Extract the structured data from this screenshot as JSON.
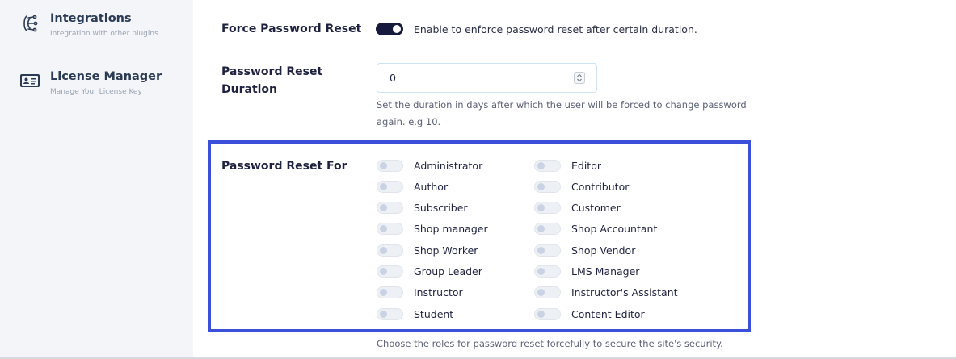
{
  "sidebar": {
    "items": [
      {
        "title": "Integrations",
        "subtitle": "Integration with other plugins",
        "icon": "integrations-icon"
      },
      {
        "title": "License Manager",
        "subtitle": "Manage Your License Key",
        "icon": "license-card-icon"
      }
    ]
  },
  "force_reset": {
    "label": "Force Password Reset",
    "enabled": true,
    "description": "Enable to enforce password reset after certain duration."
  },
  "duration": {
    "label_line1": "Password Reset",
    "label_line2": "Duration",
    "value": "0",
    "help_line1": "Set the duration in days after which the user will be forced to change password",
    "help_line2": "again. e.g 10."
  },
  "reset_for": {
    "label": "Password Reset For",
    "roles_left": [
      "Administrator",
      "Author",
      "Subscriber",
      "Shop manager",
      "Shop Worker",
      "Group Leader",
      "Instructor",
      "Student"
    ],
    "roles_right": [
      "Editor",
      "Contributor",
      "Customer",
      "Shop Accountant",
      "Shop Vendor",
      "LMS Manager",
      "Instructor's Assistant",
      "Content Editor"
    ],
    "help": "Choose the roles for password reset forcefully to secure the site's security."
  },
  "colors": {
    "sidebar_bg": "#f3f5f8",
    "toggle_on": "#161a3c",
    "highlight_border": "#3b4fd8"
  }
}
